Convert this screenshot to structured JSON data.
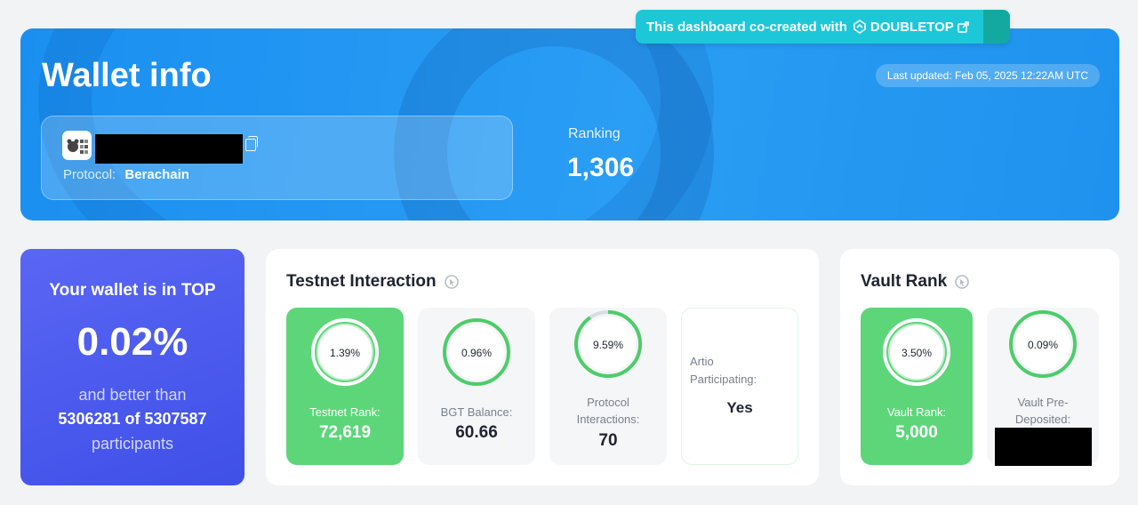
{
  "cocreated": {
    "text": "This dashboard co-created with",
    "brand": "DOUBLETOP"
  },
  "header": {
    "title": "Wallet info",
    "last_updated": "Last updated: Feb 05, 2025 12:22AM UTC",
    "protocol_label": "Protocol:",
    "protocol_value": "Berachain",
    "ranking_label": "Ranking",
    "ranking_value": "1,306"
  },
  "top_card": {
    "line1": "Your wallet is in TOP",
    "percent": "0.02%",
    "line2": "and better than",
    "line3": "5306281 of 5307587",
    "line4": "participants"
  },
  "testnet": {
    "title": "Testnet Interaction",
    "tiles": [
      {
        "ring": "1.39%",
        "ring_fraction": 1.0,
        "label": "Testnet Rank:",
        "value": "72,619"
      },
      {
        "ring": "0.96%",
        "ring_fraction": 1.0,
        "label": "BGT Balance:",
        "value": "60.66"
      },
      {
        "ring": "9.59%",
        "ring_fraction": 0.904,
        "label": "Protocol Interactions:",
        "value": "70"
      },
      {
        "label": "Artio Participating:",
        "value": "Yes"
      }
    ]
  },
  "vault": {
    "title": "Vault Rank",
    "tiles": [
      {
        "ring": "3.50%",
        "ring_fraction": 1.0,
        "label": "Vault Rank:",
        "value": "5,000"
      },
      {
        "ring": "0.09%",
        "ring_fraction": 1.0,
        "label": "Vault Pre-Deposited:"
      }
    ]
  },
  "colors": {
    "accent_blue": "#1a8ff0",
    "green": "#5dd67a",
    "ring_green": "#4ccd6a",
    "purple": "#4b5cf0"
  }
}
